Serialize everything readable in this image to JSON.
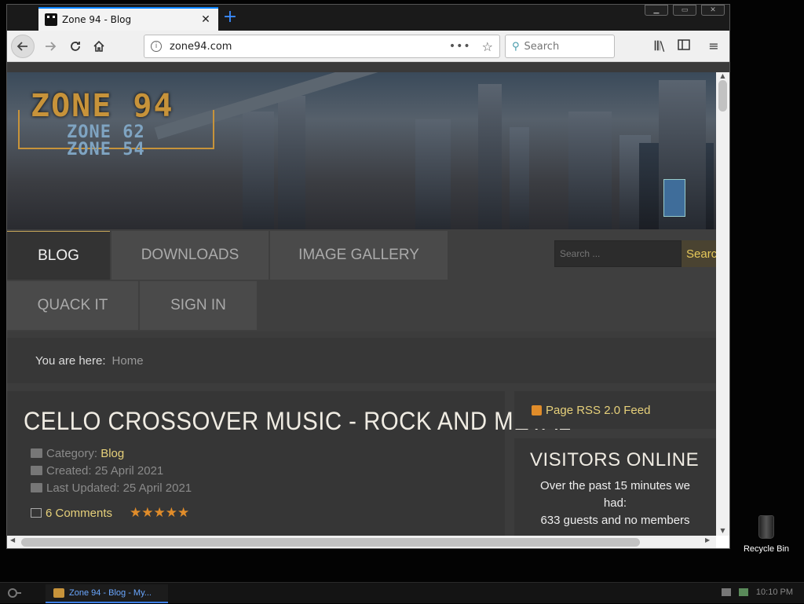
{
  "browser": {
    "tab_title": "Zone 94 - Blog",
    "tab_close": "✕",
    "new_tab": "+",
    "url": "zone94.com",
    "url_actions": "•••",
    "bookmark_star": "☆",
    "search_placeholder": "Search",
    "win_minimize": "▁",
    "win_maximize": "▭",
    "win_close": "✕"
  },
  "site": {
    "logo_main": "ZONE 94",
    "logo_sub1": "ZONE 62",
    "logo_sub2": "ZONE 54",
    "menu": [
      {
        "label": "BLOG",
        "active": true
      },
      {
        "label": "DOWNLOADS"
      },
      {
        "label": "IMAGE GALLERY"
      },
      {
        "label": "QUACK IT"
      },
      {
        "label": "SIGN IN"
      }
    ],
    "search_placeholder": "Search ...",
    "search_button": "Search",
    "breadcrumb": {
      "label": "You are here:",
      "home": "Home"
    },
    "article": {
      "title": "CELLO CROSSOVER MUSIC - ROCK AND METAL",
      "category_label": "Category:",
      "category": "Blog",
      "created": "Created: 25 April 2021",
      "updated": "Last Updated: 25 April 2021",
      "comments": "6 Comments",
      "stars": "★★★★★"
    },
    "sidebar": {
      "rss": "Page RSS 2.0 Feed",
      "visitors_title": "VISITORS ONLINE",
      "visitors_line1": "Over the past 15 minutes we had:",
      "visitors_line2": "633 guests and no members"
    }
  },
  "desktop": {
    "recycle_bin": "Recycle Bin",
    "taskbar_item": "Zone 94 - Blog - My...",
    "clock": "10:10 PM"
  },
  "colors": {
    "accent": "#0a84ff",
    "link": "#e6d07a",
    "logo": "#c7933a"
  }
}
